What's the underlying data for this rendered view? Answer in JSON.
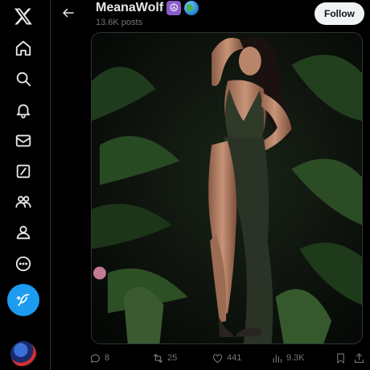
{
  "header": {
    "display_name": "MeanaWolf",
    "name_emojis": [
      "☮",
      "🌎"
    ],
    "post_count": "13.6K posts",
    "follow_label": "Follow"
  },
  "actions": {
    "replies": "8",
    "reposts": "25",
    "likes": "441",
    "views": "9.3K"
  },
  "nav": {
    "items": [
      "x-logo",
      "home-icon",
      "search-icon",
      "notifications-icon",
      "messages-icon",
      "grok-icon",
      "communities-icon",
      "profile-icon",
      "more-icon"
    ]
  },
  "colors": {
    "background": "#000000",
    "accent": "#1d9bf0",
    "text": "#e7e9ea",
    "muted": "#71767b",
    "follow_bg": "#eff3f4"
  }
}
